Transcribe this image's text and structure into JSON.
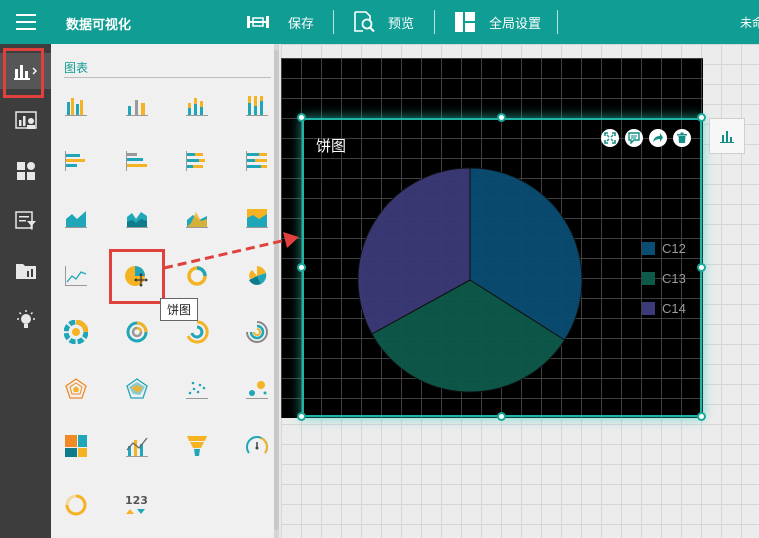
{
  "topbar": {
    "title": "数据可视化",
    "save_label": "保存",
    "preview_label": "预览",
    "global_settings_label": "全局设置",
    "right_text": "未命名"
  },
  "sidebar": {
    "items": [
      {
        "icon": "bar-chart-icon",
        "active": true
      },
      {
        "icon": "data-analysis-icon"
      },
      {
        "icon": "components-icon"
      },
      {
        "icon": "filter-icon"
      },
      {
        "icon": "folder-icon"
      },
      {
        "icon": "lightbulb-icon"
      }
    ]
  },
  "panel": {
    "title": "图表"
  },
  "tooltip": {
    "text": "饼图"
  },
  "widget": {
    "title": "饼图",
    "legend": [
      "C12",
      "C13",
      "C14"
    ]
  },
  "chart_data": {
    "type": "pie",
    "categories": [
      "C12",
      "C13",
      "C14"
    ],
    "values": [
      34,
      33,
      33
    ],
    "colors": [
      "#0a4d73",
      "#0e5a4a",
      "#3c3a78"
    ],
    "legend": "right"
  },
  "colors": {
    "accent": "#0f9d94",
    "highlight": "#e0413d",
    "icon_blue": "#1fa6b8",
    "icon_yellow": "#f5b323"
  }
}
